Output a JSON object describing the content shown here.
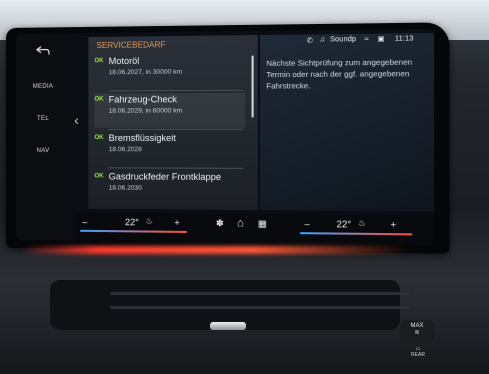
{
  "sidebar": {
    "items": [
      {
        "label": "MEDIA"
      },
      {
        "label": "TEL"
      },
      {
        "label": "NAV"
      }
    ]
  },
  "panel": {
    "title": "SERVICEBEDARF",
    "items": [
      {
        "status": "OK",
        "title": "Motoröl",
        "subtitle": "18.06.2027, in 30000 km"
      },
      {
        "status": "OK",
        "title": "Fahrzeug-Check",
        "subtitle": "18.06.2029, in 60000 km"
      },
      {
        "status": "OK",
        "title": "Bremsflüssigkeit",
        "subtitle": "18.06.2028"
      },
      {
        "status": "OK",
        "title": "Gasdruckfeder Frontklappe",
        "subtitle": "18.06.2030"
      }
    ]
  },
  "status_bar": {
    "source": "Soundp",
    "time": "11:13"
  },
  "detail": {
    "text": "Nächste Sichtprüfung zum angegebenen Termin oder nach der ggf. angegebenen Fahrstrecke."
  },
  "climate": {
    "left_temp": "22°",
    "right_temp": "22°",
    "minus": "–",
    "plus": "+"
  },
  "controls": {
    "max_label": "MAX",
    "rear_label": "REAR"
  },
  "colors": {
    "accent": "#e39a5a",
    "ok": "#9ae24a"
  }
}
